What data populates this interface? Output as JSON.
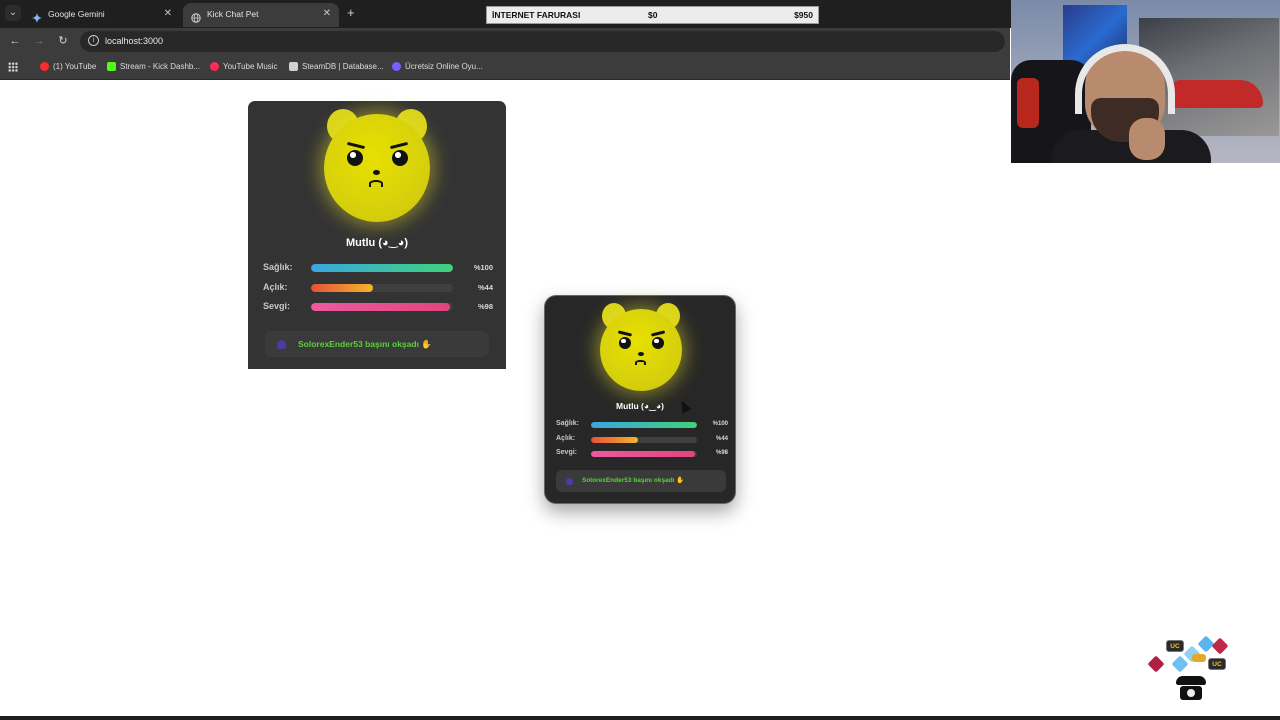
{
  "browser": {
    "tabs": [
      {
        "title": "Google Gemini",
        "active": false
      },
      {
        "title": "Kick Chat Pet",
        "active": true
      }
    ],
    "new_tab_label": "+",
    "url": "localhost:3000",
    "bookmarks": [
      {
        "label": "(1) YouTube",
        "icon": "youtube-icon",
        "color": "#ff2a2a"
      },
      {
        "label": "Stream - Kick Dashb...",
        "icon": "kick-icon",
        "color": "#53fc18"
      },
      {
        "label": "YouTube Music",
        "icon": "youtube-music-icon",
        "color": "#ff2a5a"
      },
      {
        "label": "SteamDB | Database...",
        "icon": "steamdb-icon",
        "color": "#d0d0d0"
      },
      {
        "label": "Ücretsiz Online Oyu...",
        "icon": "game-icon",
        "color": "#7a5cff"
      }
    ]
  },
  "price_overlay": {
    "title": "İNTERNET FARURASI",
    "min": "$0",
    "max": "$950"
  },
  "pet_card_large": {
    "mood": "Mutlu (◕‿◕)",
    "stats": [
      {
        "label": "Sağlık:",
        "value_text": "%100",
        "level": 1.0,
        "gradient": "linear-gradient(90deg,#3aa6e0,#3fd27a)"
      },
      {
        "label": "Açlık:",
        "value_text": "%44",
        "level": 0.44,
        "gradient": "linear-gradient(90deg,#e8503a,#f2b62a)"
      },
      {
        "label": "Sevgi:",
        "value_text": "%98",
        "level": 0.98,
        "gradient": "linear-gradient(90deg,#ec5aa0,#e2457c)"
      }
    ],
    "event_text": "SolorexEnder53 başını okşadı ✋"
  },
  "pet_card_small": {
    "mood": "Mutlu (◕‿◕)",
    "stats": [
      {
        "label": "Sağlık:",
        "value_text": "%100",
        "level": 1.0,
        "gradient": "linear-gradient(90deg,#3aa6e0,#3fd27a)"
      },
      {
        "label": "Açlık:",
        "value_text": "%44",
        "level": 0.44,
        "gradient": "linear-gradient(90deg,#e8503a,#f2b62a)"
      },
      {
        "label": "Sevgi:",
        "value_text": "%98",
        "level": 0.98,
        "gradient": "linear-gradient(90deg,#ec5aa0,#e2457c)"
      }
    ],
    "event_text": "SolorexEnder53 başını okşadı ✋"
  },
  "deco": {
    "uc_label": "UC"
  }
}
